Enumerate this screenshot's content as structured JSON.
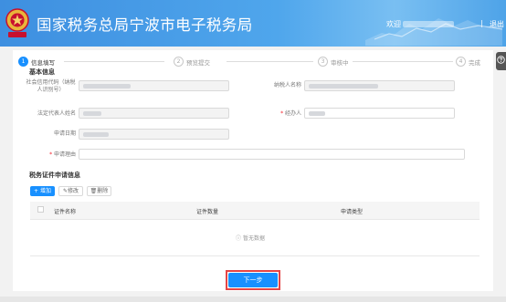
{
  "header": {
    "title": "国家税务总局宁波市电子税务局",
    "user_prefix": "欢迎",
    "separator": "|",
    "logout": "退出"
  },
  "help": {
    "icon": "question-icon"
  },
  "steps": [
    {
      "number": "1",
      "label": "信息填写",
      "active": true
    },
    {
      "number": "2",
      "label": "预览提交",
      "active": false
    },
    {
      "number": "3",
      "label": "审核中",
      "active": false
    },
    {
      "number": "4",
      "label": "完成",
      "active": false
    }
  ],
  "basic_info": {
    "section_title": "基本信息",
    "credit_code_label": "社会信用代码（纳税人识别号）",
    "taxpayer_name_label": "纳税人名称",
    "legal_rep_label": "法定代表人姓名",
    "handler_label": "经办人",
    "date_label": "申请日期",
    "reason_label": "申请理由",
    "required_mark": "*"
  },
  "cert_section": {
    "title": "税务证件申请信息",
    "add_label": "增加",
    "edit_label": "修改",
    "delete_label": "删除",
    "add_icon": "plus-icon",
    "edit_icon": "pencil-icon",
    "delete_icon": "trash-icon",
    "columns": [
      "证件名称",
      "证件数量",
      "申请类型"
    ],
    "empty_text": "暂无数据",
    "empty_icon": "info-circle-icon"
  },
  "next_button": "下一步",
  "colors": {
    "primary": "#1890ff",
    "header": "#4a9ee8",
    "highlight": "#e64545"
  }
}
